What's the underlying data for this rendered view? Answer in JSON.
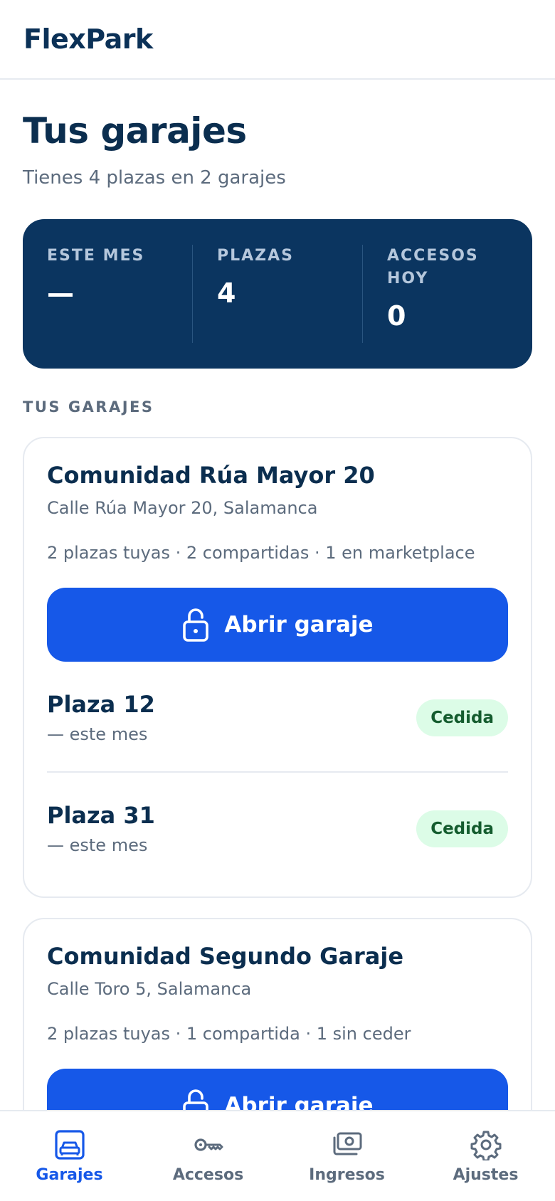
{
  "app": {
    "name": "FlexPark"
  },
  "page": {
    "title": "Tus garajes",
    "subtitle": "Tienes 4 plazas en 2 garajes"
  },
  "stats": [
    {
      "label": "ESTE MES",
      "value": "—"
    },
    {
      "label": "PLAZAS",
      "value": "4"
    },
    {
      "label": "ACCESOS HOY",
      "value": "0"
    }
  ],
  "section_label": "TUS GARAJES",
  "garages": [
    {
      "name": "Comunidad Rúa Mayor 20",
      "address": "Calle Rúa Mayor 20, Salamanca",
      "summary": "2 plazas tuyas · 2 compartidas · 1 en marketplace",
      "open_label": "Abrir garaje",
      "spots": [
        {
          "name": "Plaza 12",
          "sub": "— este mes",
          "status": "Cedida"
        },
        {
          "name": "Plaza 31",
          "sub": "— este mes",
          "status": "Cedida"
        }
      ]
    },
    {
      "name": "Comunidad Segundo Garaje",
      "address": "Calle Toro 5, Salamanca",
      "summary": "2 plazas tuyas · 1 compartida · 1 sin ceder",
      "open_label": "Abrir garaje"
    }
  ],
  "nav": [
    {
      "label": "Garajes",
      "icon": "car-icon",
      "active": true
    },
    {
      "label": "Accesos",
      "icon": "key-icon",
      "active": false
    },
    {
      "label": "Ingresos",
      "icon": "money-icon",
      "active": false
    },
    {
      "label": "Ajustes",
      "icon": "gear-icon",
      "active": false
    }
  ],
  "colors": {
    "primary": "#1658e8",
    "navy": "#0b3560",
    "badge_bg": "#dcfce7",
    "badge_text": "#145c2e"
  }
}
